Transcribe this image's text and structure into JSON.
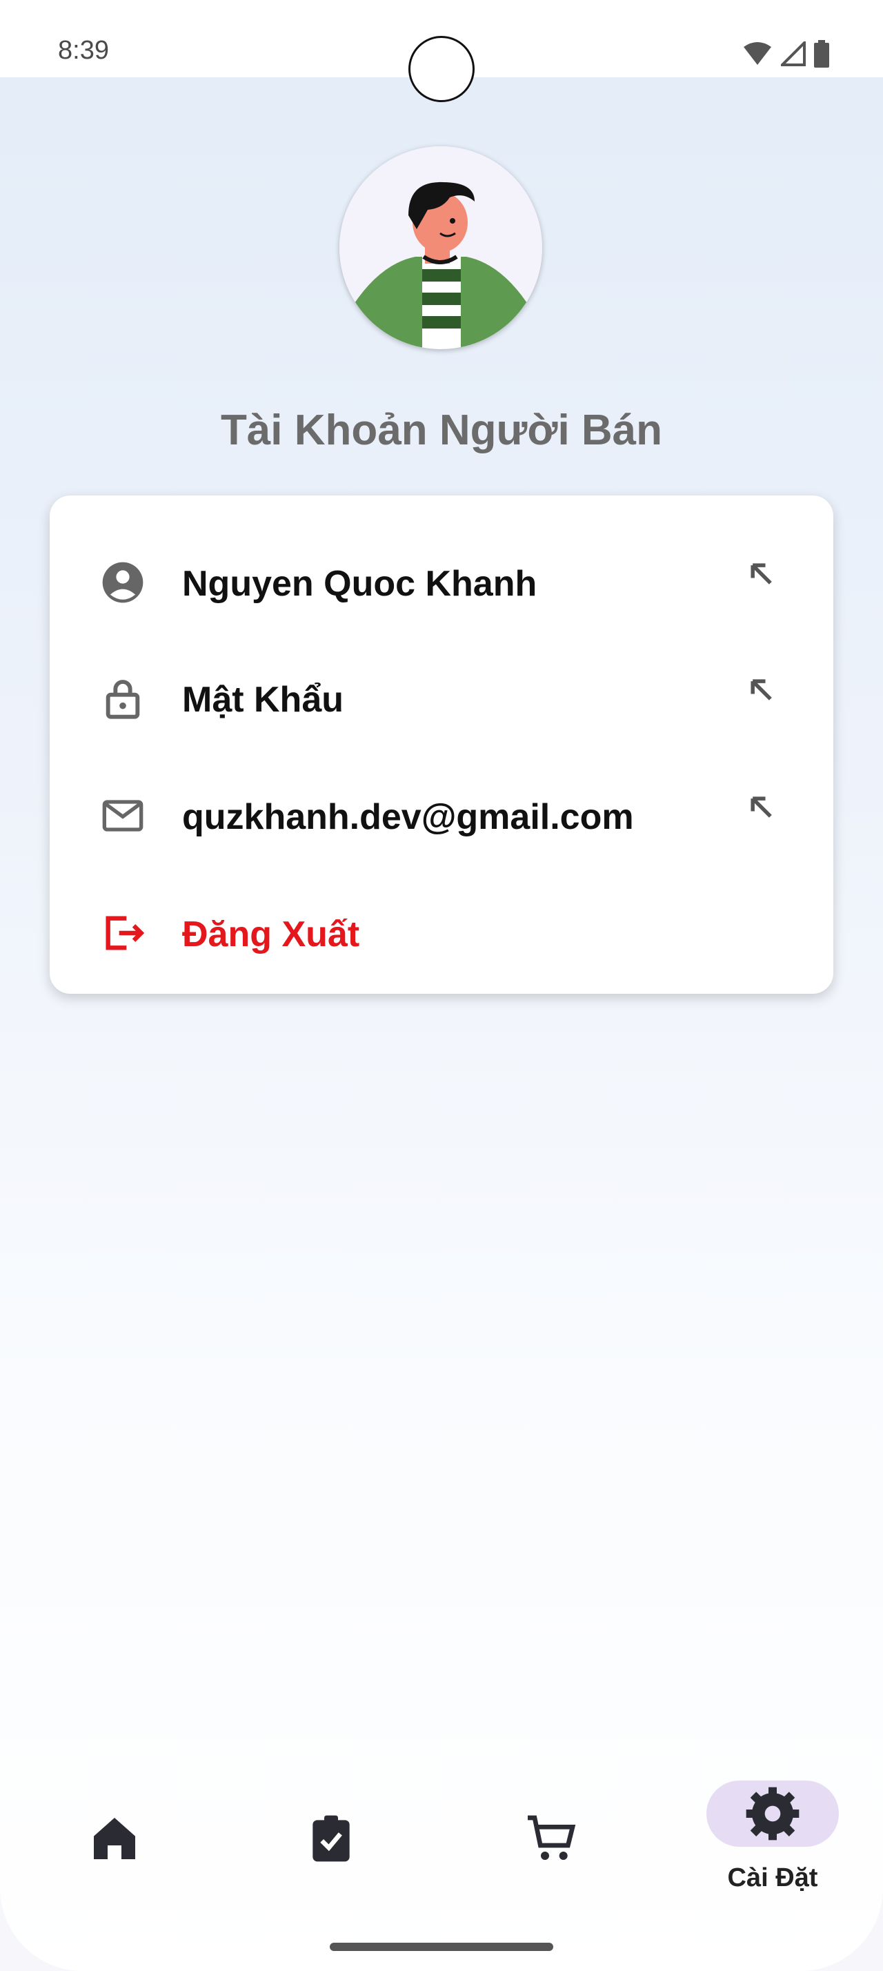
{
  "status_bar": {
    "time": "8:39"
  },
  "profile": {
    "title": "Tài Khoản Người Bán"
  },
  "menu": {
    "items": [
      {
        "label": "Nguyen Quoc Khanh",
        "icon": "account-circle-icon"
      },
      {
        "label": "Mật Khẩu",
        "icon": "lock-icon"
      },
      {
        "label": "quzkhanh.dev@gmail.com",
        "icon": "mail-icon"
      }
    ],
    "logout": {
      "label": "Đăng Xuất",
      "icon": "logout-icon"
    }
  },
  "bottom_nav": {
    "items": [
      {
        "icon": "home-icon"
      },
      {
        "icon": "clipboard-check-icon"
      },
      {
        "icon": "cart-icon"
      },
      {
        "icon": "gear-icon",
        "label": "Cài Đặt",
        "active": true
      }
    ]
  },
  "colors": {
    "logout": "#e3171c",
    "active_pill": "#e6ddf5",
    "text": "#111111",
    "title": "#6b6b6b"
  }
}
